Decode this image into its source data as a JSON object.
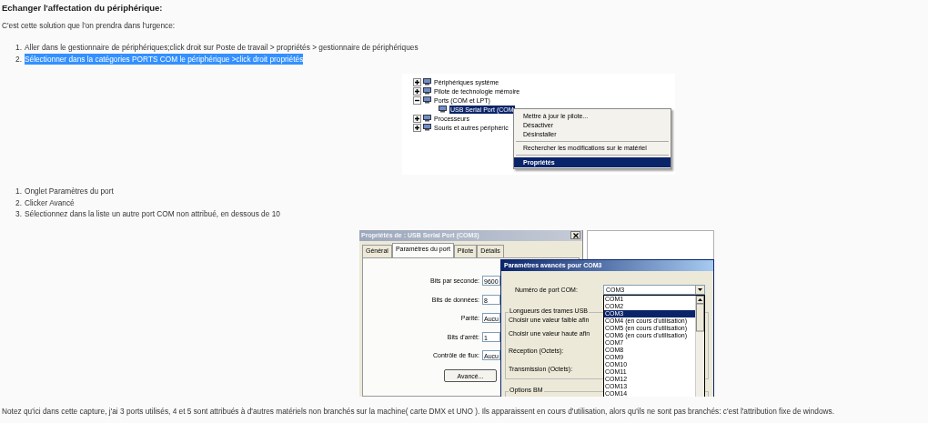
{
  "heading": "Echanger l'affectation du périphérique:",
  "intro": "C'est cette solution que l'on prendra dans l'urgence:",
  "steps_1": [
    {
      "number": "1.",
      "text": "Aller dans le gestionnaire de périphériques;click droit sur Poste de travail > propriétés > gestionnaire de périphériques",
      "selected": false
    },
    {
      "number": "2.",
      "text": "Sélectionner dans la catégories PORTS COM le périphérique >click droit propriétés",
      "selected": true
    }
  ],
  "device_manager": {
    "tree": [
      {
        "label": "Périphériques système",
        "expanded": false
      },
      {
        "label": "Pilote de technologie mémoire",
        "expanded": false
      },
      {
        "label": "Ports (COM et LPT)",
        "expanded": true,
        "children": [
          {
            "label": "USB Serial Port (COM",
            "selected": true
          }
        ]
      },
      {
        "label": "Processeurs",
        "expanded": false
      },
      {
        "label": "Souris et autres périphéric",
        "expanded": false
      }
    ],
    "context_menu": {
      "groups": [
        {
          "items": [
            {
              "label": "Mettre à jour le pilote...",
              "selected": false
            },
            {
              "label": "Désactiver",
              "selected": false
            },
            {
              "label": "Désinstaller",
              "selected": false
            }
          ]
        },
        {
          "items": [
            {
              "label": "Rechercher les modifications sur le matériel",
              "selected": false
            }
          ]
        },
        {
          "items": [
            {
              "label": "Propriétés",
              "selected": true
            }
          ]
        }
      ]
    }
  },
  "steps_2": [
    {
      "number": "1.",
      "text": "Onglet Paramètres du port"
    },
    {
      "number": "2.",
      "text": "Clicker Avancé"
    },
    {
      "number": "3.",
      "text": "Sélectionnez dans la liste un autre port COM non attribué, en dessous de 10"
    }
  ],
  "properties_dialog": {
    "title": "Propriétés de : USB Serial Port (COM3)",
    "tabs": [
      {
        "label": "Général",
        "selected": false
      },
      {
        "label": "Paramètres du port",
        "selected": true
      },
      {
        "label": "Pilote",
        "selected": false
      },
      {
        "label": "Détails",
        "selected": false
      }
    ],
    "fields": [
      {
        "label": "Bits par seconde:",
        "value": "9600"
      },
      {
        "label": "Bits de données:",
        "value": "8"
      },
      {
        "label": "Parité:",
        "value": "Aucu"
      },
      {
        "label": "Bits d'arrêt:",
        "value": "1"
      },
      {
        "label": "Contrôle de flux:",
        "value": "Aucu"
      }
    ],
    "button": "Avancé..."
  },
  "advanced_dialog": {
    "title": "Paramètres avancés pour COM3",
    "port_label": "Numéro de port COM:",
    "port_value": "COM3",
    "port_options": [
      {
        "label": "COM1",
        "selected": false
      },
      {
        "label": "COM2",
        "selected": false
      },
      {
        "label": "COM3",
        "selected": true
      },
      {
        "label": "COM4 (en cours d'utilisation)",
        "selected": false
      },
      {
        "label": "COM5 (en cours d'utilisation)",
        "selected": false
      },
      {
        "label": "COM6 (en cours d'utilisation)",
        "selected": false
      },
      {
        "label": "COM7",
        "selected": false
      },
      {
        "label": "COM8",
        "selected": false
      },
      {
        "label": "COM9",
        "selected": false
      },
      {
        "label": "COM10",
        "selected": false
      },
      {
        "label": "COM11",
        "selected": false
      },
      {
        "label": "COM12",
        "selected": false
      },
      {
        "label": "COM13",
        "selected": false
      },
      {
        "label": "COM14",
        "selected": false
      }
    ],
    "group_title": "Longueurs des trames USB",
    "rows": [
      "Choisir une valeur faible afin",
      "Choisir une valeur haute afin",
      "Réception (Octets):",
      "Transmission (Octets):"
    ],
    "options_group": "Options BM"
  },
  "note": "Notez qu'ici dans cette capture, j'ai 3 ports utilisés, 4 et 5 sont attribués à d'autres matériels non branchés sur la machine( carte DMX et UNO ). Ils apparaissent en cours d'utilisation, alors qu'ils ne sont pas branchés: c'est l'attribution fixe de windows."
}
